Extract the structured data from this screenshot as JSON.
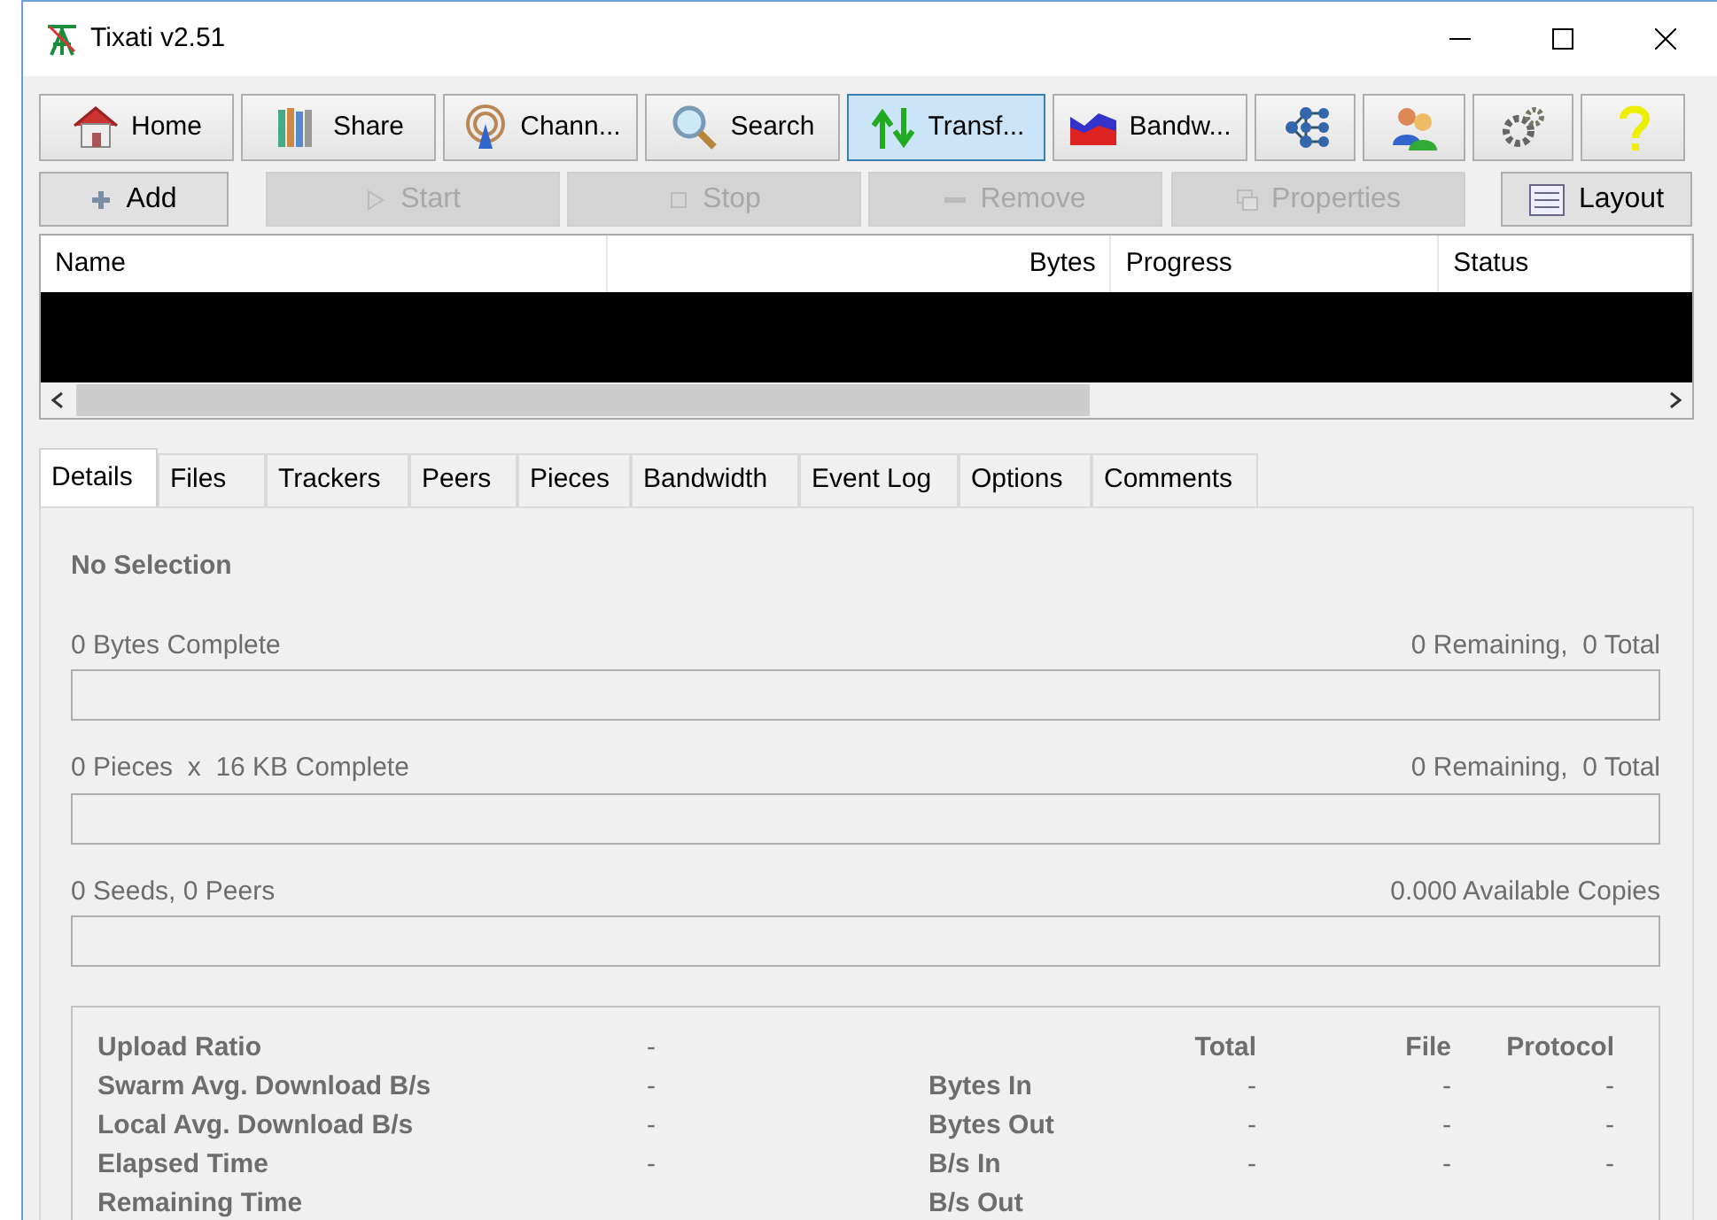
{
  "window": {
    "title": "Tixati v2.51"
  },
  "toolbar": [
    {
      "label": "Home",
      "selected": false
    },
    {
      "label": "Share",
      "selected": false
    },
    {
      "label": "Chann...",
      "selected": false
    },
    {
      "label": "Search",
      "selected": false
    },
    {
      "label": "Transf...",
      "selected": true
    },
    {
      "label": "Bandw...",
      "selected": false
    },
    {
      "selected": false
    },
    {
      "selected": false
    },
    {
      "selected": false
    },
    {
      "selected": false
    }
  ],
  "actions": [
    {
      "label": "Add",
      "disabled": false
    },
    {
      "label": "Start",
      "disabled": true
    },
    {
      "label": "Stop",
      "disabled": true
    },
    {
      "label": "Remove",
      "disabled": true
    },
    {
      "label": "Properties",
      "disabled": true
    }
  ],
  "layout_button": {
    "label": "Layout"
  },
  "table": {
    "columns": [
      "Name",
      "Bytes",
      "Progress",
      "Status"
    ]
  },
  "tabs": [
    {
      "label": "Details",
      "selected": true
    },
    {
      "label": "Files",
      "selected": false
    },
    {
      "label": "Trackers",
      "selected": false
    },
    {
      "label": "Peers",
      "selected": false
    },
    {
      "label": "Pieces",
      "selected": false
    },
    {
      "label": "Bandwidth",
      "selected": false
    },
    {
      "label": "Event Log",
      "selected": false
    },
    {
      "label": "Options",
      "selected": false
    },
    {
      "label": "Comments",
      "selected": false
    }
  ],
  "details": {
    "heading": "No Selection",
    "meters": [
      {
        "left": "0 Bytes Complete",
        "right": "0 Remaining,  0 Total",
        "level": 0
      },
      {
        "left": "0 Pieces  x  16 KB Complete",
        "right": "0 Remaining,  0 Total",
        "level": 0
      },
      {
        "left": "0 Seeds, 0 Peers",
        "right": "0.000 Available Copies",
        "level": 0
      }
    ],
    "stats": {
      "left": [
        {
          "label": "Upload Ratio",
          "value": "-"
        },
        {
          "label": "Swarm Avg. Download B/s",
          "value": "-"
        },
        {
          "label": "Local Avg. Download B/s",
          "value": "-"
        },
        {
          "label": "Elapsed Time",
          "value": "-"
        },
        {
          "label": "Remaining Time"
        }
      ],
      "headers": [
        "Total",
        "File",
        "Protocol"
      ],
      "rows": [
        {
          "label": "Bytes In",
          "values": [
            "-",
            "-",
            "-"
          ]
        },
        {
          "label": "Bytes Out",
          "values": [
            "-",
            "-",
            "-"
          ]
        },
        {
          "label": "B/s In",
          "values": [
            "-",
            "-",
            "-"
          ]
        },
        {
          "label": "B/s Out"
        }
      ]
    }
  }
}
